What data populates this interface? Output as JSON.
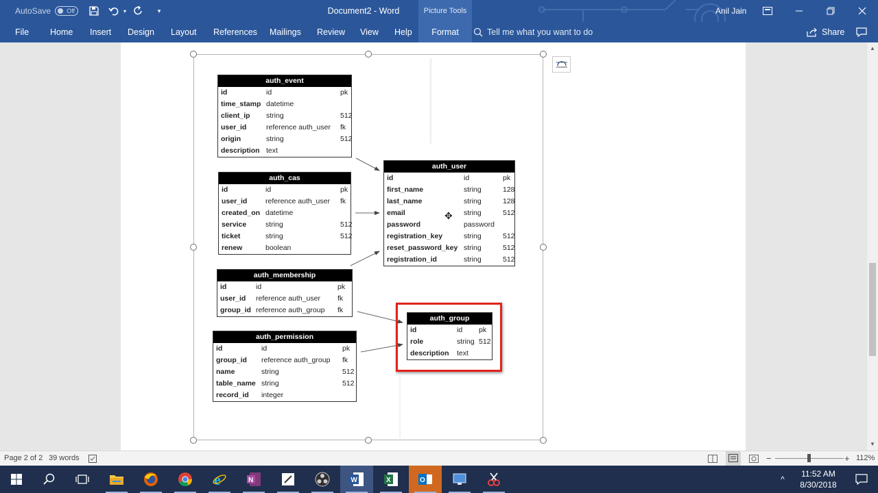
{
  "titlebar": {
    "autosave_label": "AutoSave",
    "autosave_state": "Off",
    "document_title": "Document2 - Word",
    "context_tab_group": "Picture Tools",
    "user_name": "Anil Jain"
  },
  "ribbon": {
    "tabs": [
      {
        "label": "File"
      },
      {
        "label": "Home"
      },
      {
        "label": "Insert"
      },
      {
        "label": "Design"
      },
      {
        "label": "Layout"
      },
      {
        "label": "References"
      },
      {
        "label": "Mailings"
      },
      {
        "label": "Review"
      },
      {
        "label": "View"
      },
      {
        "label": "Help"
      },
      {
        "label": "Format"
      }
    ],
    "active_tab": "Format",
    "tell_me_placeholder": "Tell me what you want to do",
    "share_label": "Share"
  },
  "diagram": {
    "auth_event": {
      "title": "auth_event",
      "rows": [
        [
          "id",
          "id",
          "pk"
        ],
        [
          "time_stamp",
          "datetime",
          ""
        ],
        [
          "client_ip",
          "string",
          "512"
        ],
        [
          "user_id",
          "reference auth_user",
          "fk"
        ],
        [
          "origin",
          "string",
          "512"
        ],
        [
          "description",
          "text",
          ""
        ]
      ]
    },
    "auth_cas": {
      "title": "auth_cas",
      "rows": [
        [
          "id",
          "id",
          "pk"
        ],
        [
          "user_id",
          "reference auth_user",
          "fk"
        ],
        [
          "created_on",
          "datetime",
          ""
        ],
        [
          "service",
          "string",
          "512"
        ],
        [
          "ticket",
          "string",
          "512"
        ],
        [
          "renew",
          "boolean",
          ""
        ]
      ]
    },
    "auth_membership": {
      "title": "auth_membership",
      "rows": [
        [
          "id",
          "id",
          "pk"
        ],
        [
          "user_id",
          "reference auth_user",
          "fk"
        ],
        [
          "group_id",
          "reference auth_group",
          "fk"
        ]
      ]
    },
    "auth_permission": {
      "title": "auth_permission",
      "rows": [
        [
          "id",
          "id",
          "pk"
        ],
        [
          "group_id",
          "reference auth_group",
          "fk"
        ],
        [
          "name",
          "string",
          "512"
        ],
        [
          "table_name",
          "string",
          "512"
        ],
        [
          "record_id",
          "integer",
          ""
        ]
      ]
    },
    "auth_user": {
      "title": "auth_user",
      "rows": [
        [
          "id",
          "id",
          "pk"
        ],
        [
          "first_name",
          "string",
          "128"
        ],
        [
          "last_name",
          "string",
          "128"
        ],
        [
          "email",
          "string",
          "512"
        ],
        [
          "password",
          "password",
          ""
        ],
        [
          "registration_key",
          "string",
          "512"
        ],
        [
          "reset_password_key",
          "string",
          "512"
        ],
        [
          "registration_id",
          "string",
          "512"
        ]
      ]
    },
    "auth_group": {
      "title": "auth_group",
      "rows": [
        [
          "id",
          "id",
          "pk"
        ],
        [
          "role",
          "string",
          "512"
        ],
        [
          "description",
          "text",
          ""
        ]
      ]
    },
    "highlight_color": "#e2231a"
  },
  "statusbar": {
    "page_info": "Page 2 of 2",
    "word_count": "39 words",
    "zoom_level": "112%"
  },
  "taskbar": {
    "time": "11:52 AM",
    "date": "8/30/2018",
    "apps": [
      "start-icon",
      "search-icon",
      "task-view-icon",
      "file-explorer-icon",
      "firefox-icon",
      "chrome-icon",
      "internet-explorer-icon",
      "onenote-icon",
      "sticky-notes-icon",
      "obs-icon",
      "word-icon",
      "excel-icon",
      "outlook-icon",
      "remote-desktop-icon",
      "snipping-tool-icon"
    ]
  },
  "colors": {
    "word_blue": "#2b579a",
    "taskbar": "#1f2f4d",
    "excel_green": "#217346",
    "outlook_orange": "#d0691f"
  }
}
